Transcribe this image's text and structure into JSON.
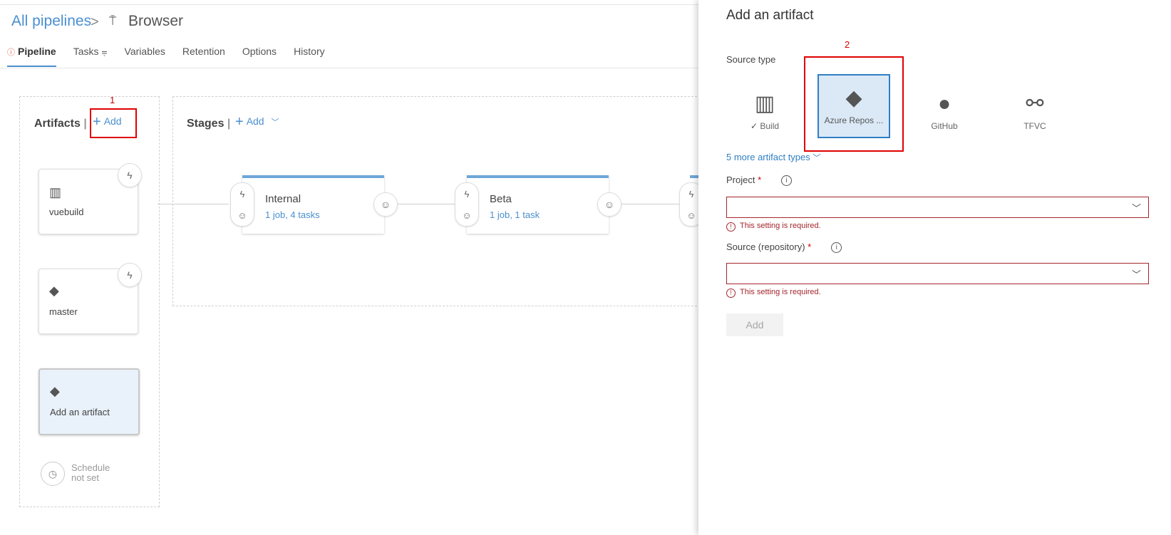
{
  "header": {
    "breadcrumb": "All pipelines",
    "breadcrumb_sep": ">",
    "pipeline_icon": "pipeline-icon",
    "title": "Browser"
  },
  "tabs": [
    {
      "label": "Pipeline",
      "active": true,
      "warning": true
    },
    {
      "label": "Tasks ⩦"
    },
    {
      "label": "Variables"
    },
    {
      "label": "Retention"
    },
    {
      "label": "Options"
    },
    {
      "label": "History"
    }
  ],
  "artifacts": {
    "label": "Artifacts",
    "add_label": "Add",
    "annotation": "1",
    "items": [
      {
        "name": "vuebuild",
        "icon": "build-icon"
      },
      {
        "name": "master",
        "icon": "git-icon"
      },
      {
        "name": "Add an artifact",
        "icon": "git-icon"
      }
    ],
    "schedule_line1": "Schedule",
    "schedule_line2": "not set"
  },
  "stages": {
    "label": "Stages",
    "add_label": "Add",
    "items": [
      {
        "name": "Internal",
        "sub": "1 job, 4 tasks"
      },
      {
        "name": "Beta",
        "sub": "1 job, 1 task"
      }
    ]
  },
  "panel": {
    "title": "Add an artifact",
    "source_type_label": "Source type",
    "annotation": "2",
    "source_types": [
      {
        "label": "Build",
        "icon": "build-icon",
        "checked": true
      },
      {
        "label": "Azure Repos ...",
        "icon": "azure-repos-icon",
        "selected": true
      },
      {
        "label": "GitHub",
        "icon": "github-icon"
      },
      {
        "label": "TFVC",
        "icon": "tfvc-icon"
      }
    ],
    "more_link": "5 more artifact types",
    "project_label": "Project",
    "source_label": "Source (repository)",
    "required_mark": "*",
    "error_text": "This setting is required.",
    "add_button": "Add"
  },
  "colors": {
    "accent": "#4a8fd0",
    "error": "#a4262c",
    "annotation": "#e00000"
  }
}
